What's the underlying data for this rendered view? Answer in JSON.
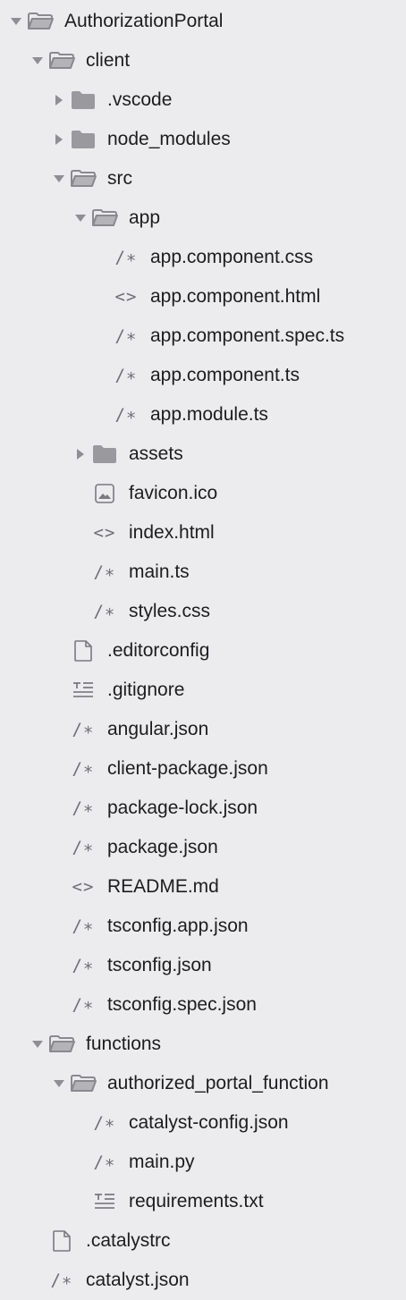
{
  "tree": {
    "items": [
      {
        "label": "AuthorizationPortal",
        "level": 0,
        "kind": "folder",
        "expanded": true
      },
      {
        "label": "client",
        "level": 1,
        "kind": "folder",
        "expanded": true
      },
      {
        "label": ".vscode",
        "level": 2,
        "kind": "folder",
        "expanded": false
      },
      {
        "label": "node_modules",
        "level": 2,
        "kind": "folder",
        "expanded": false
      },
      {
        "label": "src",
        "level": 2,
        "kind": "folder",
        "expanded": true
      },
      {
        "label": "app",
        "level": 3,
        "kind": "folder",
        "expanded": true
      },
      {
        "label": "app.component.css",
        "level": 4,
        "kind": "comment-file"
      },
      {
        "label": "app.component.html",
        "level": 4,
        "kind": "markup-file"
      },
      {
        "label": "app.component.spec.ts",
        "level": 4,
        "kind": "comment-file"
      },
      {
        "label": "app.component.ts",
        "level": 4,
        "kind": "comment-file"
      },
      {
        "label": "app.module.ts",
        "level": 4,
        "kind": "comment-file"
      },
      {
        "label": "assets",
        "level": 3,
        "kind": "folder",
        "expanded": false
      },
      {
        "label": "favicon.ico",
        "level": 3,
        "kind": "image-file"
      },
      {
        "label": "index.html",
        "level": 3,
        "kind": "markup-file"
      },
      {
        "label": "main.ts",
        "level": 3,
        "kind": "comment-file"
      },
      {
        "label": "styles.css",
        "level": 3,
        "kind": "comment-file"
      },
      {
        "label": ".editorconfig",
        "level": 2,
        "kind": "blank-file"
      },
      {
        "label": ".gitignore",
        "level": 2,
        "kind": "text-file"
      },
      {
        "label": "angular.json",
        "level": 2,
        "kind": "comment-file"
      },
      {
        "label": "client-package.json",
        "level": 2,
        "kind": "comment-file"
      },
      {
        "label": "package-lock.json",
        "level": 2,
        "kind": "comment-file"
      },
      {
        "label": "package.json",
        "level": 2,
        "kind": "comment-file"
      },
      {
        "label": "README.md",
        "level": 2,
        "kind": "markup-file"
      },
      {
        "label": "tsconfig.app.json",
        "level": 2,
        "kind": "comment-file"
      },
      {
        "label": "tsconfig.json",
        "level": 2,
        "kind": "comment-file"
      },
      {
        "label": "tsconfig.spec.json",
        "level": 2,
        "kind": "comment-file"
      },
      {
        "label": "functions",
        "level": 1,
        "kind": "folder",
        "expanded": true
      },
      {
        "label": "authorized_portal_function",
        "level": 2,
        "kind": "folder",
        "expanded": true
      },
      {
        "label": "catalyst-config.json",
        "level": 3,
        "kind": "comment-file"
      },
      {
        "label": "main.py",
        "level": 3,
        "kind": "comment-file"
      },
      {
        "label": "requirements.txt",
        "level": 3,
        "kind": "text-file"
      },
      {
        "label": ".catalystrc",
        "level": 1,
        "kind": "blank-file"
      },
      {
        "label": "catalyst.json",
        "level": 1,
        "kind": "comment-file"
      }
    ]
  },
  "glyphs": {
    "comment-file": "/∗",
    "markup-file": "<>"
  },
  "colors": {
    "background": "#ececef",
    "icon": "#8a8a8e",
    "text": "#1d1d1f"
  }
}
